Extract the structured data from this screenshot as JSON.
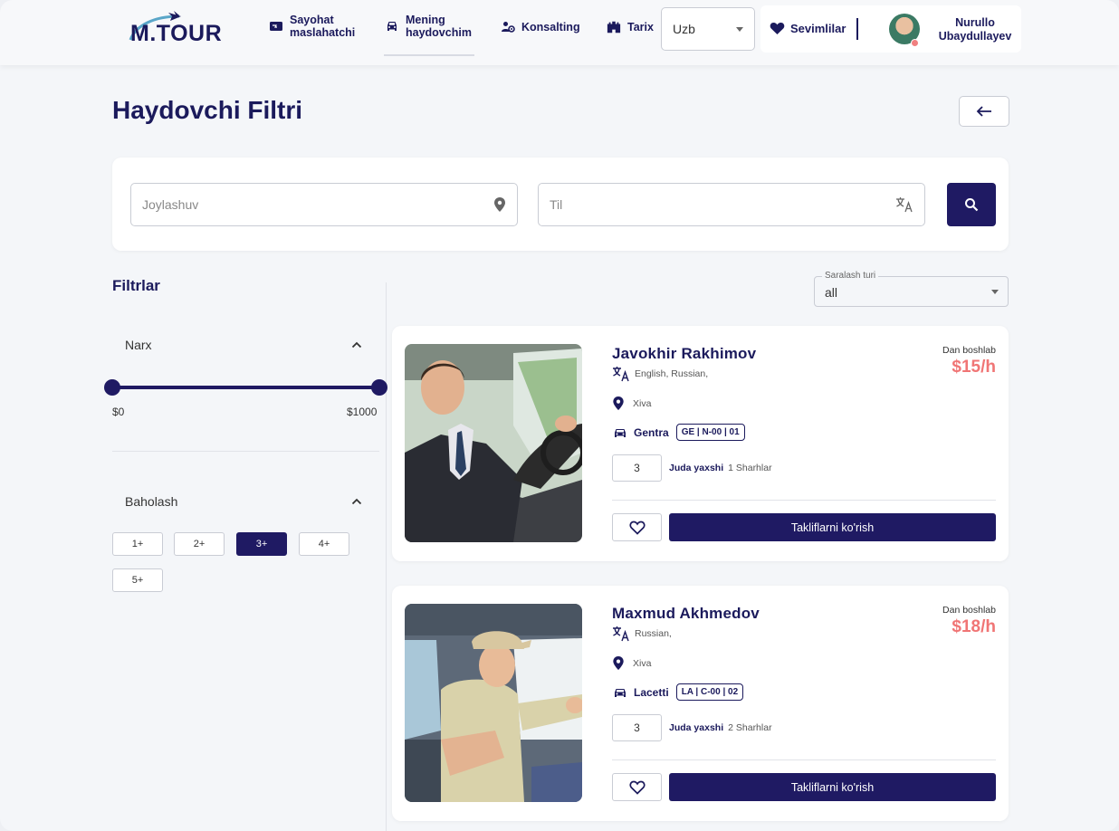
{
  "header": {
    "logo_text": "M.TOUR",
    "nav": [
      {
        "label_line1": "Sayohat",
        "label_line2": "maslahatchi",
        "icon": "ticket-icon"
      },
      {
        "label_line1": "Mening",
        "label_line2": "haydovchim",
        "icon": "car-icon"
      },
      {
        "label_line1": "Konsalting",
        "label_line2": "",
        "icon": "consulting-icon"
      },
      {
        "label_line1": "Tarix",
        "label_line2": "",
        "icon": "castle-icon"
      }
    ],
    "language": "Uzb",
    "favorites_label": "Sevimlilar",
    "user": {
      "first_name": "Nurullo",
      "last_name": "Ubaydullayev"
    }
  },
  "page": {
    "title": "Haydovchi Filtri"
  },
  "search": {
    "location_placeholder": "Joylashuv",
    "language_placeholder": "Til"
  },
  "filters": {
    "title": "Filtrlar",
    "price": {
      "label": "Narx",
      "min_label": "$0",
      "max_label": "$1000",
      "range": [
        0,
        1000
      ]
    },
    "rating": {
      "label": "Baholash",
      "options": [
        "1+",
        "2+",
        "3+",
        "4+",
        "5+"
      ],
      "selected": "3+"
    }
  },
  "sort": {
    "label": "Saralash turi",
    "value": "all"
  },
  "drivers": [
    {
      "name": "Javokhir Rakhimov",
      "languages": "English, Russian,",
      "city": "Xiva",
      "car": "Gentra",
      "plate": "GE | N-00 | 01",
      "rating": "3",
      "rating_text": "Juda yaxshi",
      "reviews": "1 Sharhlar",
      "from_label": "Dan boshlab",
      "price": "$15/h",
      "offer_button": "Takliflarni ko'rish"
    },
    {
      "name": "Maxmud Akhmedov",
      "languages": "Russian,",
      "city": "Xiva",
      "car": "Lacetti",
      "plate": "LA | C-00 | 02",
      "rating": "3",
      "rating_text": "Juda yaxshi",
      "reviews": "2 Sharhlar",
      "from_label": "Dan boshlab",
      "price": "$18/h",
      "offer_button": "Takliflarni ko'rish"
    }
  ],
  "colors": {
    "primary": "#1f1a63",
    "price": "#f07575",
    "background": "#f4f6f9"
  }
}
